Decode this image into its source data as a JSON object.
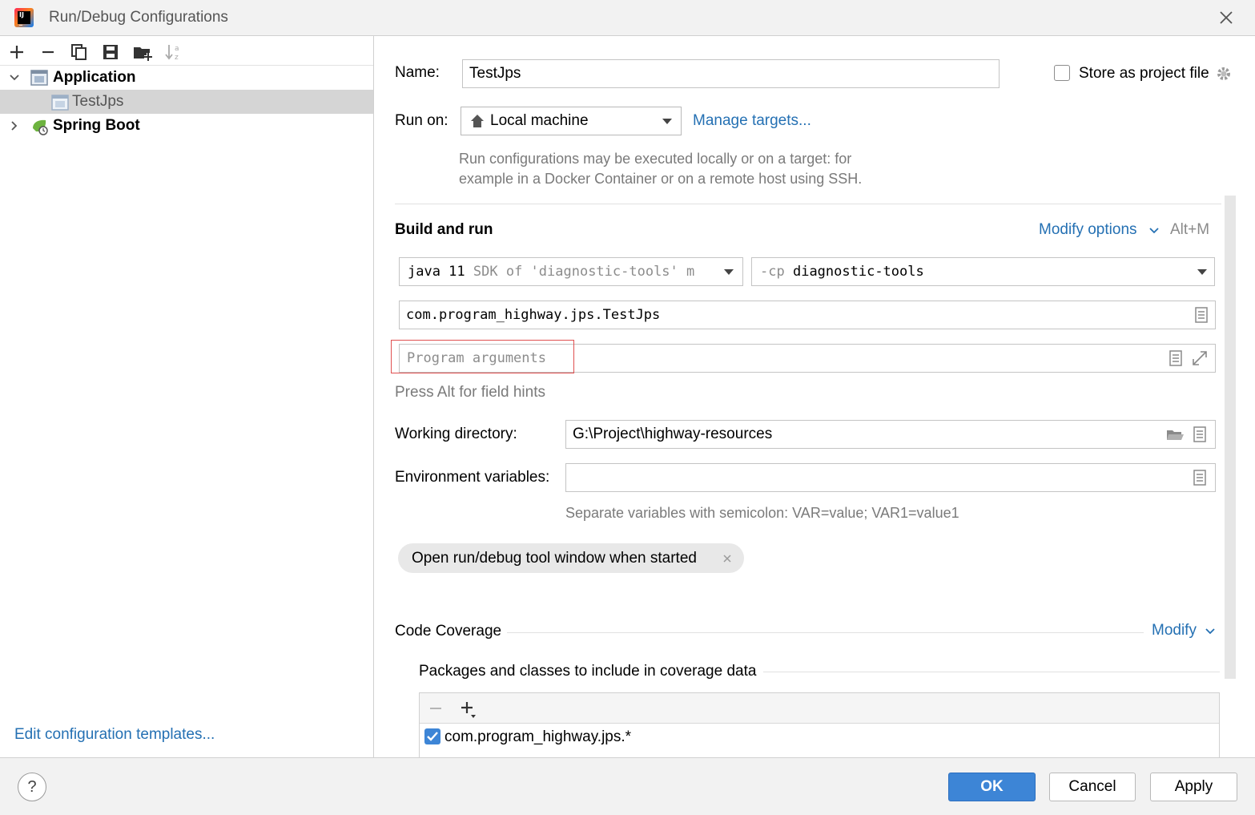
{
  "window": {
    "title": "Run/Debug Configurations"
  },
  "sidebar": {
    "tree": [
      {
        "label": "Application",
        "expanded": true
      },
      {
        "label": "TestJps",
        "selected": true
      },
      {
        "label": "Spring Boot",
        "expanded": false
      }
    ],
    "edit_templates_link": "Edit configuration templates..."
  },
  "form": {
    "name_label": "Name:",
    "name_value": "TestJps",
    "store_as_project_file": {
      "label": "Store as project file",
      "checked": false
    },
    "run_on_label": "Run on:",
    "run_on_value": "Local machine",
    "manage_targets_link": "Manage targets...",
    "run_on_hint_line1": "Run configurations may be executed locally or on a target: for",
    "run_on_hint_line2": "example in a Docker Container or on a remote host using SSH.",
    "build_and_run_heading": "Build and run",
    "modify_options_link": "Modify options",
    "modify_options_shortcut": "Alt+M",
    "jre": {
      "prefix": "java 11",
      "detail": "SDK of 'diagnostic-tools' m"
    },
    "classpath": {
      "prefix": "-cp",
      "value": "diagnostic-tools"
    },
    "main_class": "com.program_highway.jps.TestJps",
    "program_args_placeholder": "Program arguments",
    "field_hints": "Press Alt for field hints",
    "working_dir_label": "Working directory:",
    "working_dir_value": "G:\\Project\\highway-resources",
    "env_vars_label": "Environment variables:",
    "env_vars_value": "",
    "env_vars_hint": "Separate variables with semicolon: VAR=value; VAR1=value1",
    "tag_open_tool_window": "Open run/debug tool window when started",
    "code_coverage_heading": "Code Coverage",
    "code_coverage_modify": "Modify",
    "coverage_packages_heading": "Packages and classes to include in coverage data",
    "coverage_entries": [
      {
        "label": "com.program_highway.jps.*",
        "checked": true
      }
    ]
  },
  "buttons": {
    "ok": "OK",
    "cancel": "Cancel",
    "apply": "Apply",
    "help": "?"
  },
  "colors": {
    "accent": "#3d85d6",
    "link": "#2470b3",
    "selection": "#d5d5d5",
    "highlight_box": "#e05050"
  }
}
